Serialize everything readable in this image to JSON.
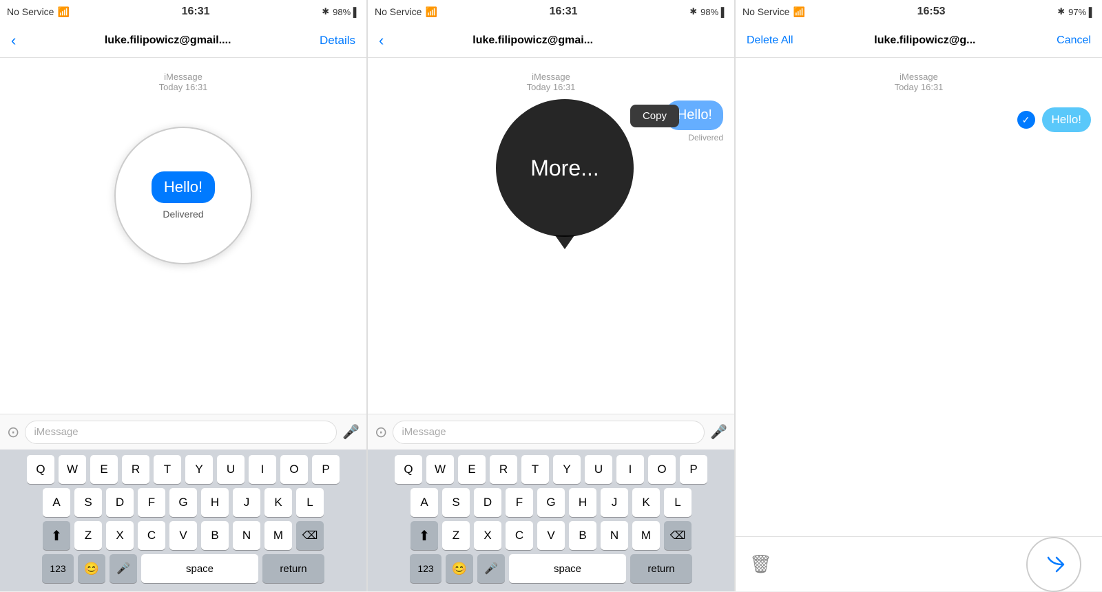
{
  "panel1": {
    "status": {
      "left": "No Service",
      "wifi": "📶",
      "time": "16:31",
      "bluetooth": "✱",
      "battery": "98% ▌"
    },
    "nav": {
      "back": "‹",
      "title": "luke.filipowicz@gmail....",
      "action": "Details"
    },
    "message": {
      "timestamp": "iMessage\nToday 16:31",
      "bubble_text": "Hello!",
      "delivered": "Delivered"
    },
    "input_placeholder": "iMessage",
    "keyboard": {
      "row1": [
        "Q",
        "W",
        "E",
        "R",
        "T",
        "Y",
        "U",
        "I",
        "O",
        "P"
      ],
      "row2": [
        "A",
        "S",
        "D",
        "F",
        "G",
        "H",
        "J",
        "K",
        "L"
      ],
      "row3": [
        "Z",
        "X",
        "C",
        "V",
        "B",
        "N",
        "M"
      ],
      "bottom": [
        "123",
        "😊",
        "🎤",
        "space",
        "return"
      ]
    }
  },
  "panel2": {
    "status": {
      "left": "No Service",
      "wifi": "📶",
      "time": "16:31",
      "bluetooth": "✱",
      "battery": "98% ▌"
    },
    "nav": {
      "back": "‹",
      "title": "luke.filipowicz@gmai...",
      "action": ""
    },
    "message": {
      "timestamp": "iMessage\nToday 16:31",
      "bubble_text": "Hello!",
      "delivered": "Delivered"
    },
    "context": {
      "copy": "Copy",
      "more": "More..."
    },
    "input_placeholder": "iMessage"
  },
  "panel3": {
    "status": {
      "left": "No Service",
      "wifi": "📶",
      "time": "16:53",
      "bluetooth": "✱",
      "battery": "97% ▌"
    },
    "nav": {
      "delete_all": "Delete All",
      "title": "luke.filipowicz@g...",
      "cancel": "Cancel"
    },
    "message": {
      "timestamp": "iMessage\nToday 16:31",
      "bubble_text": "Hello!"
    },
    "checkmark": "✓"
  }
}
